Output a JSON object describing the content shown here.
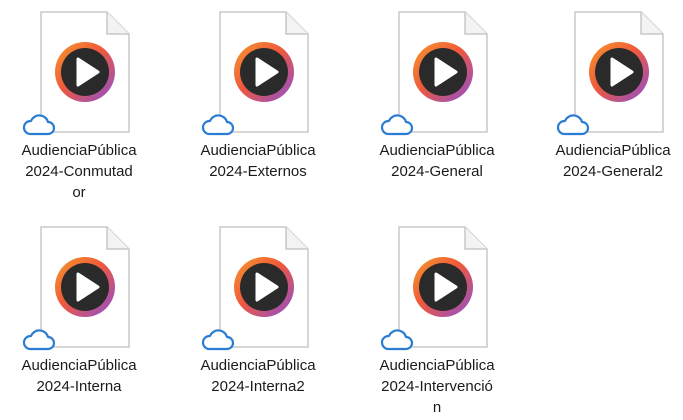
{
  "files": [
    {
      "line1": "AudienciaPública",
      "line2": "2024-Conmutad",
      "line3": "or",
      "icon": "media-player-file-icon",
      "status_icon": "cloud-online-icon"
    },
    {
      "line1": "AudienciaPública",
      "line2": "2024-Externos",
      "line3": "",
      "icon": "media-player-file-icon",
      "status_icon": "cloud-online-icon"
    },
    {
      "line1": "AudienciaPública",
      "line2": "2024-General",
      "line3": "",
      "icon": "media-player-file-icon",
      "status_icon": "cloud-online-icon"
    },
    {
      "line1": "AudienciaPública",
      "line2": "2024-General2",
      "line3": "",
      "icon": "media-player-file-icon",
      "status_icon": "cloud-online-icon"
    },
    {
      "line1": "AudienciaPública",
      "line2": "2024-Interna",
      "line3": "",
      "icon": "media-player-file-icon",
      "status_icon": "cloud-online-icon"
    },
    {
      "line1": "AudienciaPública",
      "line2": "2024-Interna2",
      "line3": "",
      "icon": "media-player-file-icon",
      "status_icon": "cloud-online-icon"
    },
    {
      "line1": "AudienciaPública",
      "line2": "2024-Intervenció",
      "line3": "n",
      "icon": "media-player-file-icon",
      "status_icon": "cloud-online-icon"
    }
  ],
  "colors": {
    "cloud_blue": "#2b7cd3",
    "play_ring_orange": "#f07a2b",
    "play_ring_purple": "#8a4fd6",
    "play_disc": "#2a2a2a",
    "page_outline": "#c8c8c8"
  }
}
